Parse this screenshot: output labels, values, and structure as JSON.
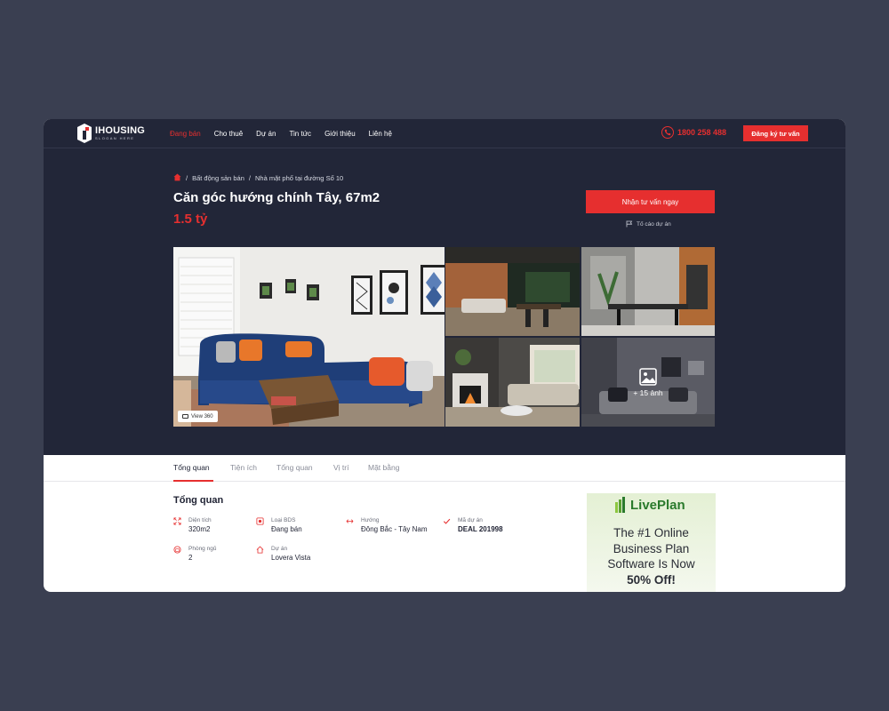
{
  "brand": {
    "name": "IHOUSING",
    "slogan": "SLOGAN HERE"
  },
  "nav": {
    "items": [
      {
        "label": "Đang bán",
        "active": true
      },
      {
        "label": "Cho thuê",
        "active": false
      },
      {
        "label": "Dự án",
        "active": false
      },
      {
        "label": "Tin tức",
        "active": false
      },
      {
        "label": "Giới thiệu",
        "active": false
      },
      {
        "label": "Liên hệ",
        "active": false
      }
    ],
    "phone": "1800 258 488",
    "register_label": "Đăng ký tư vấn"
  },
  "breadcrumb": {
    "level1": "Bất động sản bán",
    "level2": "Nhà mặt phố tại đường Số 10"
  },
  "listing": {
    "title": "Căn góc hướng chính Tây, 67m2",
    "price": "1.5 tỷ",
    "consult_label": "Nhận tư vấn ngay",
    "report_label": "Tố cáo dự án"
  },
  "gallery": {
    "view360_label": "View 360",
    "more_label": "+ 15 ảnh"
  },
  "tabs": [
    {
      "label": "Tổng quan",
      "active": true
    },
    {
      "label": "Tiện ích",
      "active": false
    },
    {
      "label": "Tổng quan",
      "active": false
    },
    {
      "label": "Vị trí",
      "active": false
    },
    {
      "label": "Mặt bằng",
      "active": false
    }
  ],
  "overview": {
    "title": "Tổng quan",
    "facts": [
      {
        "label": "Diện tích",
        "value": "320m2",
        "icon": "area-icon"
      },
      {
        "label": "Loại BDS",
        "value": "Đang bán",
        "icon": "property-type-icon"
      },
      {
        "label": "Hướng",
        "value": "Đông Bắc - Tây Nam",
        "icon": "direction-icon"
      },
      {
        "label": "Mã dự án",
        "value": "DEAL 201998",
        "icon": "check-icon"
      },
      {
        "label": "Phòng ngủ",
        "value": "2",
        "icon": "bedroom-icon"
      },
      {
        "label": "Dự án",
        "value": "Lovera Vista",
        "icon": "home-icon"
      }
    ]
  },
  "ad": {
    "brand": "LivePlan",
    "line1": "The #1 Online",
    "line2": "Business Plan",
    "line3": "Software Is Now",
    "line4": "50% Off!"
  },
  "colors": {
    "accent": "#e62f2f",
    "hero_bg": "#222638",
    "page_bg": "#3a3f51"
  }
}
